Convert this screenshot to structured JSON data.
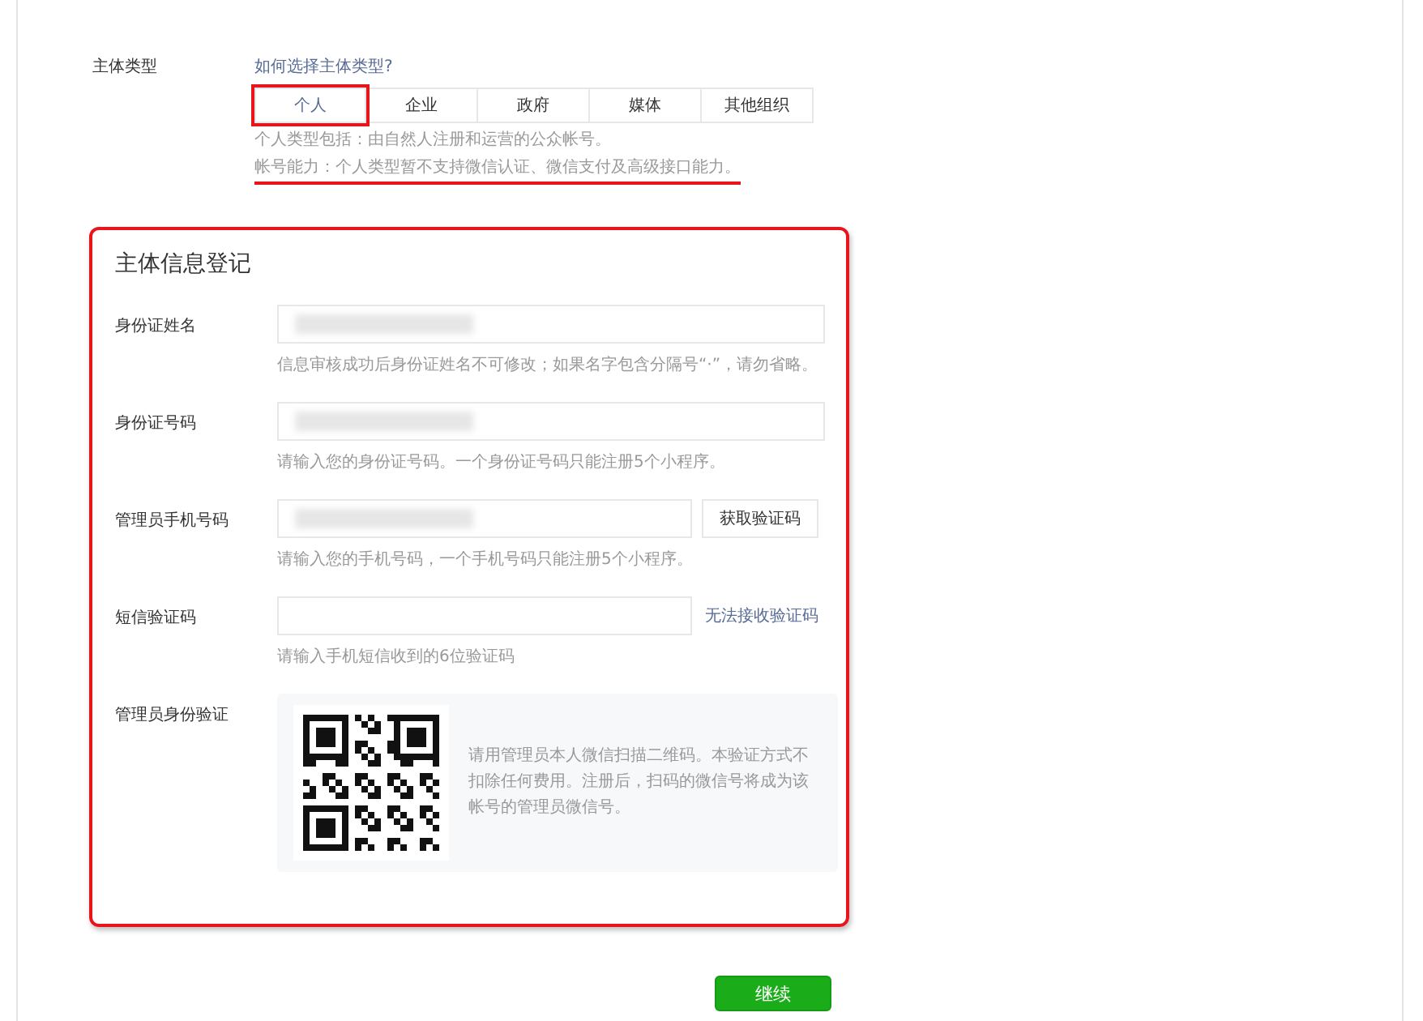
{
  "subject_type": {
    "label": "主体类型",
    "help_link": "如何选择主体类型?",
    "tabs": [
      {
        "label": "个人",
        "selected": true
      },
      {
        "label": "企业",
        "selected": false
      },
      {
        "label": "政府",
        "selected": false
      },
      {
        "label": "媒体",
        "selected": false
      },
      {
        "label": "其他组织",
        "selected": false
      }
    ],
    "notes": [
      "个人类型包括：由自然人注册和运营的公众帐号。",
      "帐号能力：个人类型暂不支持微信认证、微信支付及高级接口能力。"
    ]
  },
  "registration": {
    "title": "主体信息登记",
    "fields": [
      {
        "kind": "input",
        "label": "身份证姓名",
        "redacted": true,
        "hint": "信息审核成功后身份证姓名不可修改；如果名字包含分隔号“·”，请勿省略。"
      },
      {
        "kind": "input",
        "label": "身份证号码",
        "redacted": true,
        "hint": "请输入您的身份证号码。一个身份证号码只能注册5个小程序。"
      },
      {
        "kind": "button",
        "label": "管理员手机号码",
        "redacted": true,
        "action": "获取验证码",
        "hint": "请输入您的手机号码，一个手机号码只能注册5个小程序。"
      },
      {
        "kind": "link",
        "label": "短信验证码",
        "redacted": false,
        "action": "无法接收验证码",
        "hint": "请输入手机短信收到的6位验证码"
      },
      {
        "kind": "qr",
        "label": "管理员身份验证",
        "text": "请用管理员本人微信扫描二维码。本验证方式不扣除任何费用。注册后，扫码的微信号将成为该帐号的管理员微信号。"
      }
    ]
  },
  "continue_button": "继续"
}
